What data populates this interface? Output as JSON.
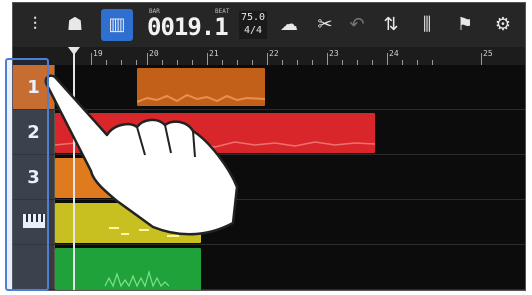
{
  "toolbar": {
    "buttons": [
      {
        "name": "waveform-icon",
        "glyph": "⫶"
      },
      {
        "name": "mixer-people-icon",
        "glyph": "☗"
      },
      {
        "name": "keyboard-icon",
        "glyph": "▥",
        "active": true
      },
      {
        "name": "cloud-icon",
        "glyph": "☁"
      },
      {
        "name": "tools-icon",
        "glyph": "✂"
      },
      {
        "name": "undo-icon",
        "glyph": "↶"
      },
      {
        "name": "loop-icon",
        "glyph": "⇅"
      },
      {
        "name": "mixer-faders-icon",
        "glyph": "⫼"
      },
      {
        "name": "marker-flag-icon",
        "glyph": "⚑"
      },
      {
        "name": "settings-gear-icon",
        "glyph": "⚙"
      }
    ],
    "counter": "0019.1",
    "counter_label_left": "BAR",
    "counter_label_right": "BEAT",
    "tempo": "75.0",
    "time_signature": "4/4"
  },
  "ruler": {
    "bars": [
      "19",
      "20",
      "21",
      "22",
      "23",
      "24",
      "25"
    ]
  },
  "tracks": [
    {
      "label": "1",
      "color": "#d86a1a",
      "selected": true
    },
    {
      "label": "2",
      "color": "#d8262a"
    },
    {
      "label": "3",
      "color": "#e07a1e"
    },
    {
      "label": "keyboard",
      "color": "#c8c020"
    },
    {
      "label": "",
      "color": "#1fa23a"
    }
  ],
  "colors": {
    "highlight": "#4f7fd4",
    "active": "#2f6fd0"
  }
}
